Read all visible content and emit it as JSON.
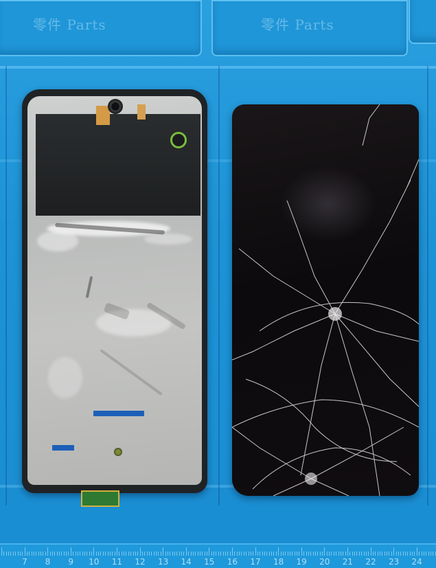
{
  "mat": {
    "tray_labels": [
      "零件 Parts",
      "零件 Parts"
    ],
    "ruler_numbers": [
      "7",
      "8",
      "9",
      "10",
      "11",
      "12",
      "13",
      "14",
      "15",
      "16",
      "17",
      "18",
      "19",
      "20",
      "21",
      "22",
      "23",
      "24"
    ],
    "color": "#1e95d6"
  },
  "objects": {
    "frame": {
      "color": "#c4c5c3",
      "bezel_color": "#1f2326"
    },
    "screen": {
      "color": "#0c0a0c",
      "crack_color": "#e8e8e8"
    }
  }
}
